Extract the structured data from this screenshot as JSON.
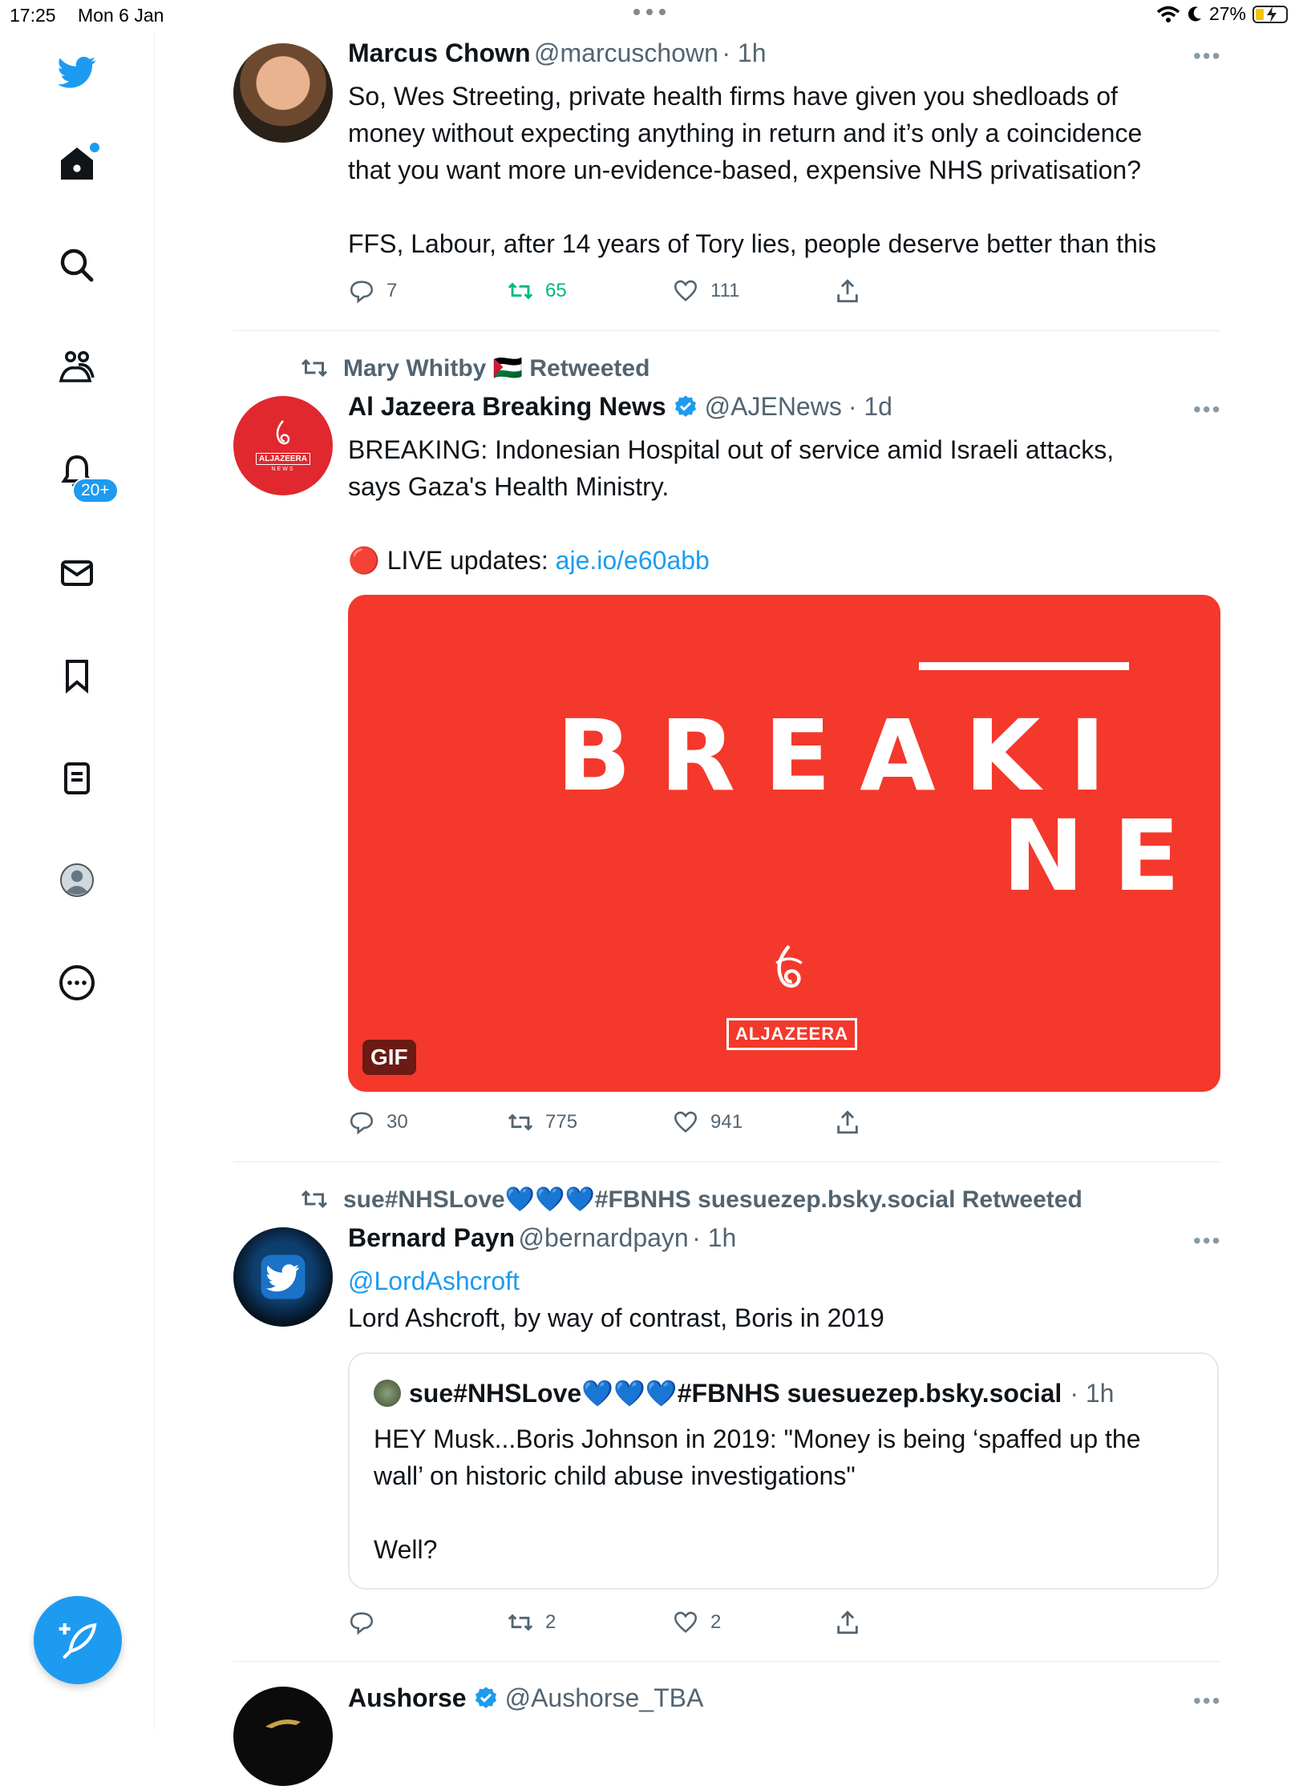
{
  "status": {
    "time": "17:25",
    "date": "Mon 6 Jan",
    "battery": "27%"
  },
  "sidebar": {
    "notifications_badge": "20+"
  },
  "tweets": [
    {
      "name": "Marcus Chown",
      "handle": "@marcuschown",
      "time": "· 1h",
      "lines": [
        "So, Wes Streeting, private health firms have given you shedloads of",
        "money without expecting anything in return and it’s only a coincidence",
        "that you want more un-evidence-based, expensive NHS privatisation?",
        "FFS, Labour, after 14 years of Tory lies, people deserve better than this"
      ],
      "replies": "7",
      "retweets": "65",
      "likes": "111"
    },
    {
      "retweeted_by": "Mary Whitby 🇵🇸 Retweeted",
      "name": "Al Jazeera Breaking News",
      "handle": "@AJENews",
      "time": "· 1d",
      "lines": [
        "BREAKING: Indonesian Hospital out of service amid Israeli attacks,",
        "says Gaza's Health Ministry."
      ],
      "live_prefix": "🔴 LIVE updates: ",
      "live_link": "aje.io/e60abb",
      "media": {
        "word1": "BREAKI",
        "word2": "NE",
        "brand": "ALJAZEERA",
        "badge": "GIF",
        "avatar_brand": "ALJAZEERA",
        "avatar_sub": "NEWS"
      },
      "replies": "30",
      "retweets": "775",
      "likes": "941"
    },
    {
      "retweeted_by": "sue#NHSLove💙💙💙#FBNHS suesuezep.bsky.social Retweeted",
      "name": "Bernard Payn",
      "handle": "@bernardpayn",
      "time": "· 1h",
      "mention": "@LordAshcroft",
      "lines": [
        "Lord Ashcroft, by way of contrast, Boris in 2019"
      ],
      "quote": {
        "name": "sue#NHSLove💙💙💙#FBNHS suesuezep.bsky.social",
        "time": "· 1h",
        "lines": [
          "HEY Musk...Boris Johnson in 2019: \"Money is being ‘spaffed up the",
          "wall’ on historic child abuse investigations\"",
          "Well?"
        ]
      },
      "replies": "",
      "retweets": "2",
      "likes": "2"
    },
    {
      "name": "Aushorse",
      "handle": "@Aushorse_TBA"
    }
  ]
}
